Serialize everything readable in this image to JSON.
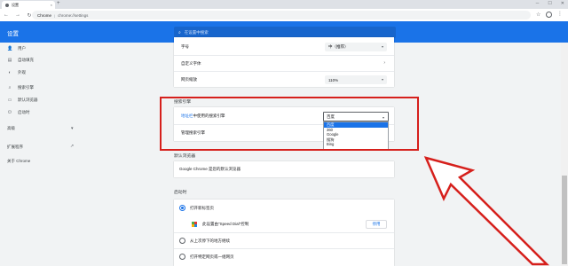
{
  "tab": {
    "title": "设置",
    "close": "×",
    "new_tab": "+"
  },
  "window": {
    "minimize": "─",
    "maximize": "☐",
    "close": "✕"
  },
  "toolbar": {
    "back": "←",
    "forward": "→",
    "reload": "↻",
    "site": "Chrome",
    "separator": "|",
    "url": "chrome://settings",
    "star": "☆",
    "menu": "⋮"
  },
  "header": {
    "title": "设置",
    "search_placeholder": "在设置中搜索"
  },
  "sidebar": {
    "items": [
      {
        "label": "用户",
        "icon": "person-icon",
        "glyph": "👤"
      },
      {
        "label": "自动填充",
        "icon": "autofill-icon",
        "glyph": "▤"
      },
      {
        "label": "外观",
        "icon": "palette-icon",
        "glyph": "◐"
      },
      {
        "label": "搜索引擎",
        "icon": "search-icon",
        "glyph": "⌕"
      },
      {
        "label": "默认浏览器",
        "icon": "browser-icon",
        "glyph": "▭"
      },
      {
        "label": "启动时",
        "icon": "power-icon",
        "glyph": "⏻"
      }
    ],
    "advanced": "高级",
    "advanced_chevron": "▾",
    "extensions": "扩展程序",
    "extensions_glyph": "↗",
    "about": "关于 Chrome"
  },
  "appearance": {
    "font_size_label": "字号",
    "font_size_value": "中（推荐）",
    "custom_fonts_label": "自定义字体",
    "zoom_label": "网页缩放",
    "zoom_value": "110%"
  },
  "search_engine": {
    "section_title": "搜索引擎",
    "row_label_link": "地址栏",
    "row_label_rest": "中使用的搜索引擎",
    "selected": "百度",
    "options": [
      "百度",
      "360",
      "Google",
      "搜狗",
      "Bing"
    ],
    "manage_label": "管理搜索引擎",
    "caret": "▾",
    "arrow": "›"
  },
  "default_browser": {
    "section_title": "默认浏览器",
    "text": "Google Chrome 是您的默认浏览器"
  },
  "startup": {
    "section_title": "启动时",
    "option1": "打开新标签页",
    "ext_text": "此设置由\"Speed Dial\"控制",
    "disable_button": "停用",
    "option2": "从上次停下的地方继续",
    "option3": "打开特定网页或一组网页"
  },
  "colors": {
    "accent": "#1a73e8",
    "annotation_red": "#d6201c",
    "grid_icon": [
      "#4caf50",
      "#e53935",
      "#ffb300",
      "#1e88e5"
    ]
  }
}
